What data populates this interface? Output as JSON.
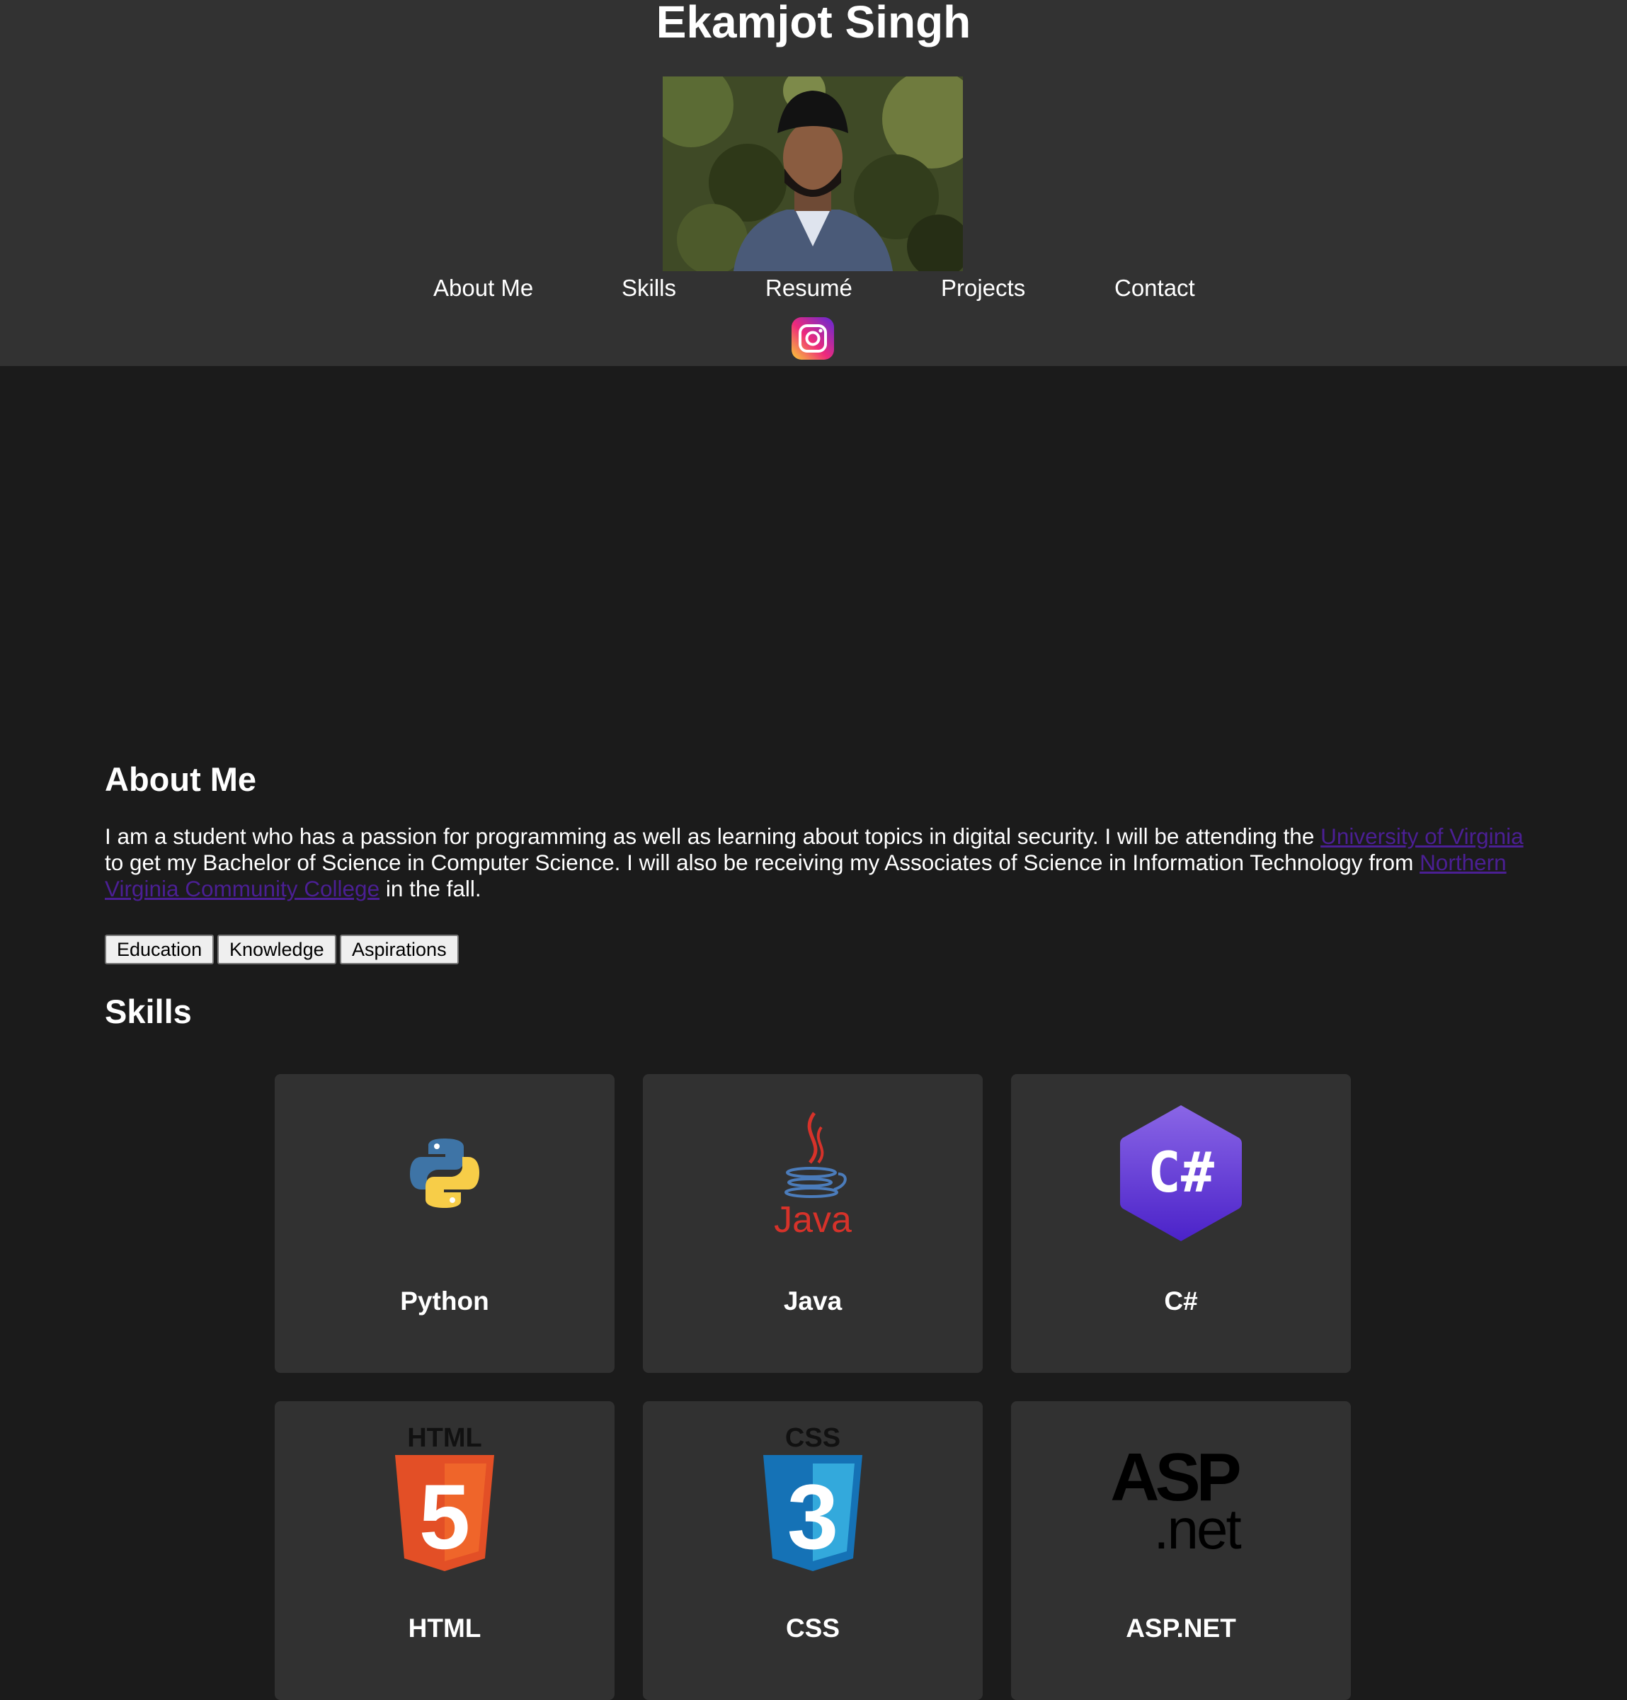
{
  "header": {
    "title": "Ekamjot Singh",
    "nav": [
      "About Me",
      "Skills",
      "Resumé",
      "Projects",
      "Contact"
    ],
    "social_icon": "instagram-icon"
  },
  "about": {
    "heading": "About Me",
    "text_1": "I am a student who has a passion for programming as well as learning about topics in digital security. I will be attending the ",
    "link_1": "University of Virginia",
    "text_2": " to get my Bachelor of Science in Computer Science. I will also be receiving my Associates of Science in Information Technology from ",
    "link_2": "Northern Virginia Community College",
    "text_3": " in the fall.",
    "buttons": [
      "Education",
      "Knowledge",
      "Aspirations"
    ]
  },
  "skills": {
    "heading": "Skills",
    "cards": [
      {
        "label": "Python",
        "icon": "python-logo"
      },
      {
        "label": "Java",
        "icon": "java-logo"
      },
      {
        "label": "C#",
        "icon": "csharp-logo"
      },
      {
        "label": "HTML",
        "icon": "html5-logo"
      },
      {
        "label": "CSS",
        "icon": "css3-logo"
      },
      {
        "label": "ASP.NET",
        "icon": "aspnet-logo"
      }
    ]
  },
  "logo_text": {
    "java": "Java",
    "csharp": "C#",
    "html_badge": "HTML",
    "html_shield": "5",
    "css_badge": "CSS",
    "css_shield": "3",
    "asp_top": "ASP",
    "asp_bottom": ".net"
  },
  "colors": {
    "header_bg": "#323232",
    "page_bg": "#1b1b1b",
    "card_bg": "#313131",
    "link": "#4b1f94"
  }
}
